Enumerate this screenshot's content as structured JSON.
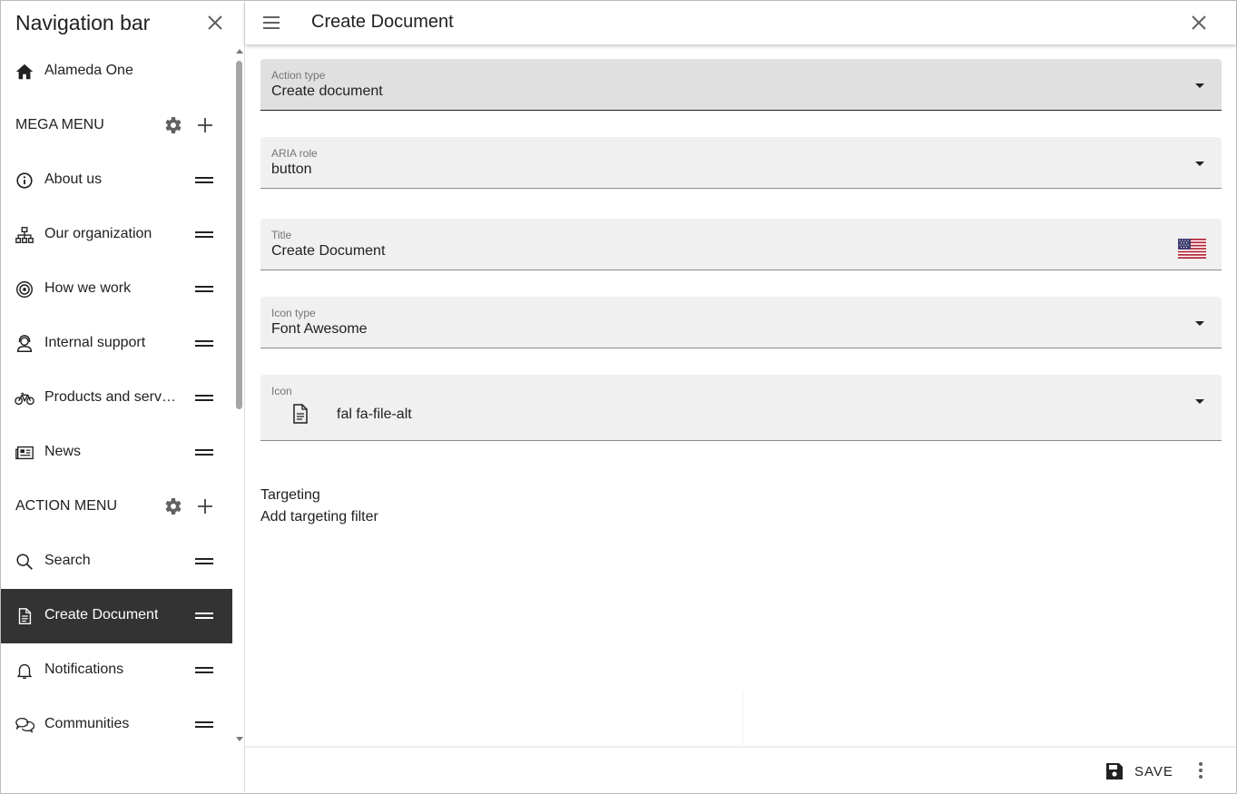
{
  "sidebar": {
    "title": "Navigation bar",
    "items": [
      {
        "label": "Alameda One",
        "icon": "home-icon"
      },
      {
        "label": "MEGA MENU",
        "section": true
      },
      {
        "label": "About us",
        "icon": "info-icon"
      },
      {
        "label": "Our organization",
        "icon": "sitemap-icon"
      },
      {
        "label": "How we work",
        "icon": "bullseye-icon"
      },
      {
        "label": "Internal support",
        "icon": "support-agent-icon"
      },
      {
        "label": "Products and servi…",
        "icon": "bicycle-icon"
      },
      {
        "label": "News",
        "icon": "newspaper-icon"
      },
      {
        "label": "ACTION MENU",
        "section": true
      },
      {
        "label": "Search",
        "icon": "search-icon"
      },
      {
        "label": "Create Document",
        "icon": "file-icon",
        "active": true
      },
      {
        "label": "Notifications",
        "icon": "bell-icon"
      },
      {
        "label": "Communities",
        "icon": "comments-icon"
      }
    ]
  },
  "header": {
    "title": "Create Document"
  },
  "form": {
    "action_type": {
      "label": "Action type",
      "value": "Create document"
    },
    "aria_role": {
      "label": "ARIA role",
      "value": "button"
    },
    "title": {
      "label": "Title",
      "value": "Create Document"
    },
    "icon_type": {
      "label": "Icon type",
      "value": "Font Awesome"
    },
    "icon": {
      "label": "Icon",
      "value": "fal fa-file-alt"
    }
  },
  "targeting": {
    "title": "Targeting",
    "add_label": "Add targeting filter"
  },
  "footer": {
    "save_label": "SAVE"
  },
  "colors": {
    "active_bg": "#333333",
    "field_bg": "#f0f0f0",
    "focused_field_bg": "#e0e0e0"
  }
}
